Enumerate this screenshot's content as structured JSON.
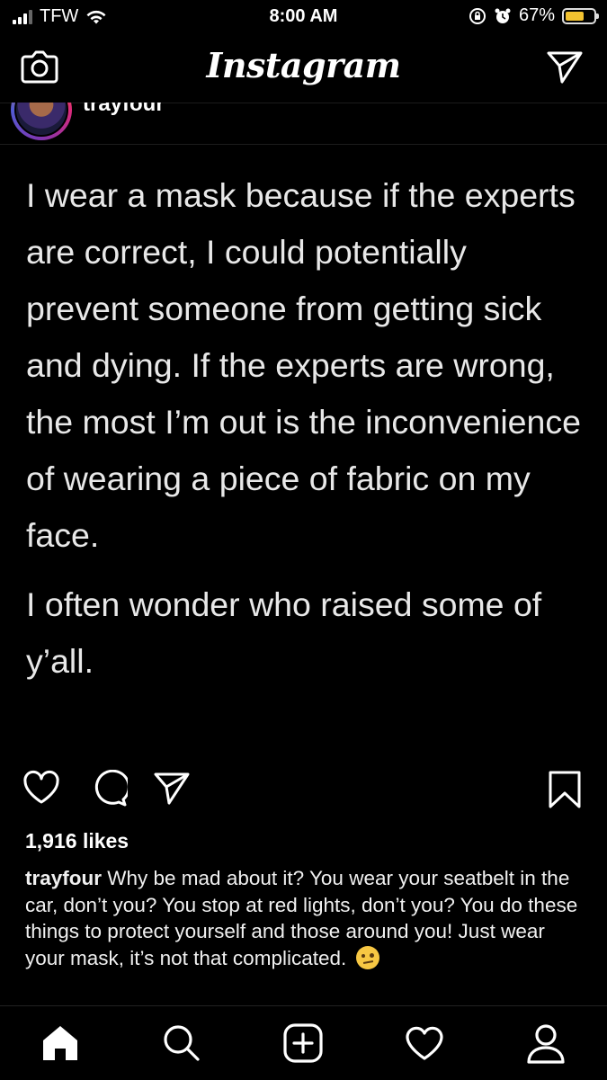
{
  "status_bar": {
    "carrier": "TFW",
    "time": "8:00 AM",
    "battery_percent": "67%",
    "battery_level": 0.67,
    "battery_color": "#f2c230"
  },
  "header": {
    "title": "Instagram",
    "left_icon": "camera-icon",
    "right_icon": "direct-message-icon"
  },
  "post": {
    "username": "trayfour",
    "paragraphs": [
      "I wear a mask because if the experts are correct, I could potentially prevent someone from getting sick and dying. If the experts are wrong, the most I’m out is the inconvenience of wearing a piece of fabric on my face.",
      "I often wonder who raised some of y’all."
    ],
    "actions": [
      "heart-icon",
      "comment-icon",
      "share-icon",
      "bookmark-icon"
    ],
    "likes": "1,916 likes",
    "caption_user": "trayfour",
    "caption_text": " Why be mad about it? You wear your seatbelt in the car, don’t you? You stop at red lights, don’t you? You do these things to protect yourself and those around you! Just wear your mask, it’s not that complicated. ",
    "caption_emoji": "face-with-raised-eyebrow-emoji"
  },
  "tab_bar": {
    "items": [
      "home-icon",
      "search-icon",
      "new-post-icon",
      "activity-heart-icon",
      "profile-icon"
    ],
    "active": "home-icon"
  }
}
